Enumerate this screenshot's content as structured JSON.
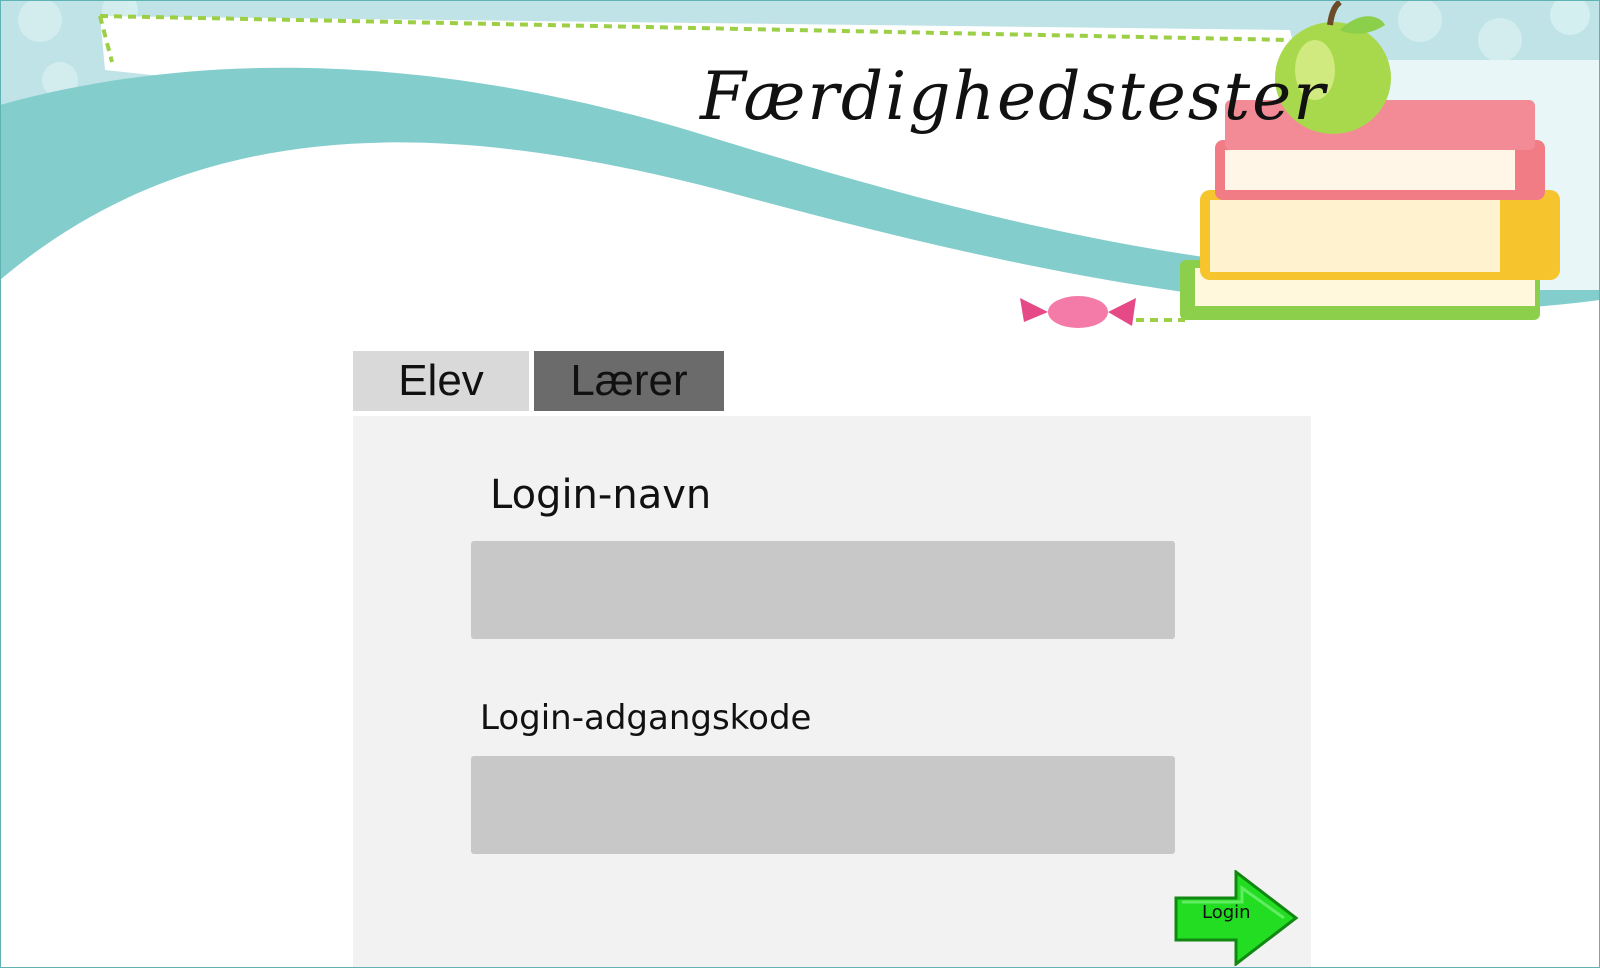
{
  "app": {
    "title": "Færdighedstester"
  },
  "tabs": [
    {
      "label": "Elev"
    },
    {
      "label": "Lærer"
    }
  ],
  "form": {
    "username_label": "Login-navn",
    "username_value": "",
    "password_label": "Login-adgangskode",
    "password_value": "",
    "submit_label": "Login"
  },
  "colors": {
    "teal": "#84cdcd",
    "panel": "#f2f2f2",
    "input": "#c8c8c8",
    "tab_active": "#d9d9d9",
    "tab_inactive": "#6b6b6b",
    "login_arrow": "#22dd22"
  },
  "icons": [
    "apple-icon",
    "books-icon",
    "candy-icon",
    "arrow-right-icon"
  ]
}
